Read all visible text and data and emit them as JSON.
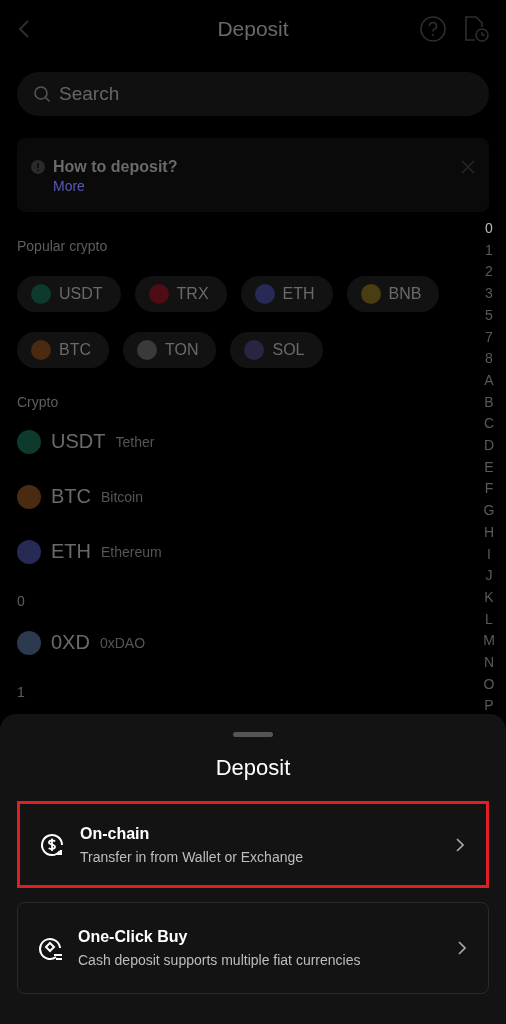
{
  "header": {
    "title": "Deposit"
  },
  "search": {
    "placeholder": "Search"
  },
  "notice": {
    "title": "How to deposit?",
    "link": "More"
  },
  "popular": {
    "heading": "Popular crypto",
    "chips": [
      {
        "symbol": "USDT",
        "color": "#0d3a2c"
      },
      {
        "symbol": "TRX",
        "color": "#4e0d12"
      },
      {
        "symbol": "ETH",
        "color": "#262a55"
      },
      {
        "symbol": "BNB",
        "color": "#4a3d12"
      },
      {
        "symbol": "BTC",
        "color": "#4a2a10"
      },
      {
        "symbol": "TON",
        "color": "#3a3a3a"
      },
      {
        "symbol": "SOL",
        "color": "#2a2440"
      }
    ]
  },
  "crypto": {
    "heading": "Crypto",
    "coins": [
      {
        "symbol": "USDT",
        "name": "Tether",
        "color": "#0d3a2c"
      },
      {
        "symbol": "BTC",
        "name": "Bitcoin",
        "color": "#4a2a10"
      },
      {
        "symbol": "ETH",
        "name": "Ethereum",
        "color": "#262a55"
      }
    ]
  },
  "groups": [
    {
      "heading": "0",
      "coins": [
        {
          "symbol": "0XD",
          "name": "0xDAO",
          "color": "#2c3a50"
        }
      ]
    },
    {
      "heading": "1"
    }
  ],
  "index": [
    {
      "label": "0",
      "selected": true
    },
    {
      "label": "1",
      "selected": false
    },
    {
      "label": "2",
      "selected": false
    },
    {
      "label": "3",
      "selected": false
    },
    {
      "label": "5",
      "selected": false
    },
    {
      "label": "7",
      "selected": false
    },
    {
      "label": "8",
      "selected": false
    },
    {
      "label": "A",
      "selected": false
    },
    {
      "label": "B",
      "selected": false
    },
    {
      "label": "C",
      "selected": false
    },
    {
      "label": "D",
      "selected": false
    },
    {
      "label": "E",
      "selected": false
    },
    {
      "label": "F",
      "selected": false
    },
    {
      "label": "G",
      "selected": false
    },
    {
      "label": "H",
      "selected": false
    },
    {
      "label": "I",
      "selected": false
    },
    {
      "label": "J",
      "selected": false
    },
    {
      "label": "K",
      "selected": false
    },
    {
      "label": "L",
      "selected": false
    },
    {
      "label": "M",
      "selected": false
    },
    {
      "label": "N",
      "selected": false
    },
    {
      "label": "O",
      "selected": false
    },
    {
      "label": "P",
      "selected": false
    }
  ],
  "sheet": {
    "title": "Deposit",
    "options": [
      {
        "kind": "onchain",
        "title": "On-chain",
        "subtitle": "Transfer in from Wallet or Exchange",
        "highlighted": true
      },
      {
        "kind": "buy",
        "title": "One-Click Buy",
        "subtitle": "Cash deposit supports multiple fiat currencies",
        "highlighted": false
      }
    ]
  }
}
